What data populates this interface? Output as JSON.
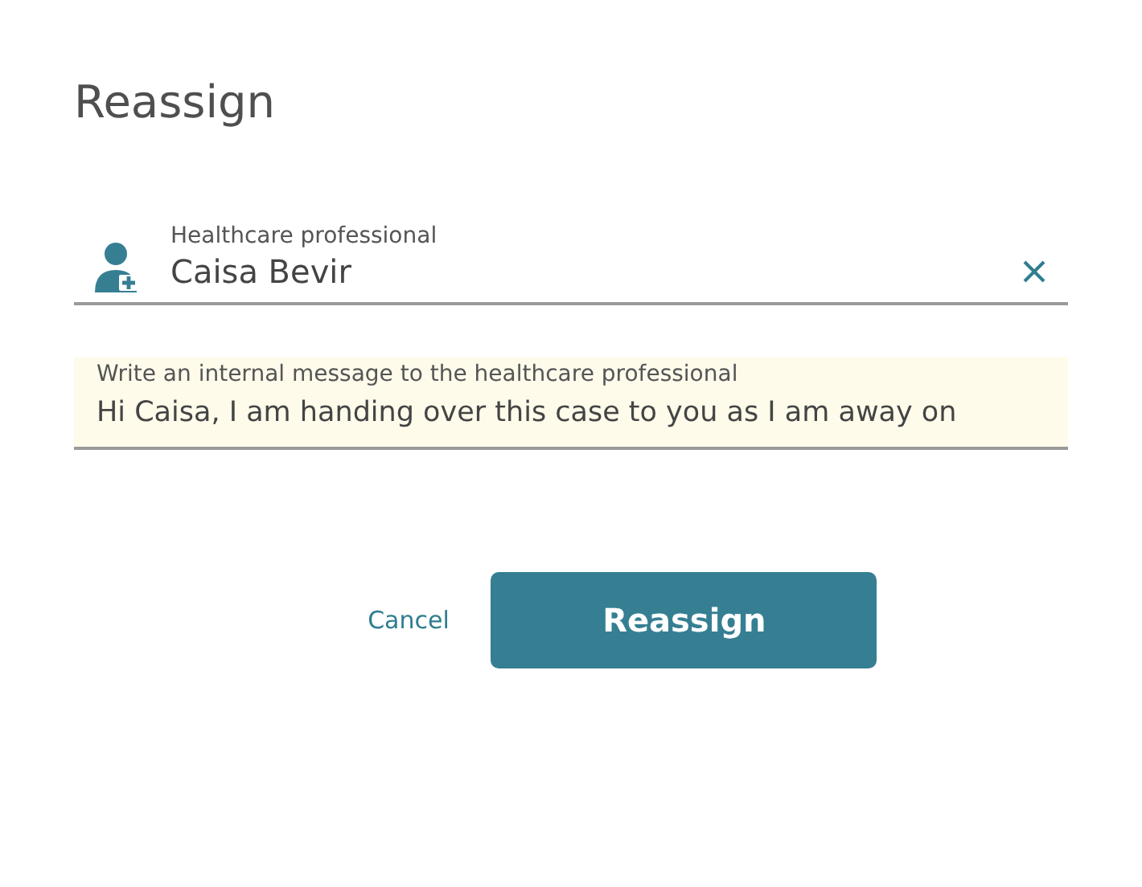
{
  "dialog": {
    "title": "Reassign"
  },
  "professional_field": {
    "label": "Healthcare professional",
    "value": "Caisa Bevir"
  },
  "message_field": {
    "label": "Write an internal message to the healthcare professional",
    "value": "Hi Caisa, I am handing over this case to you as I am away on"
  },
  "buttons": {
    "cancel": "Cancel",
    "confirm": "Reassign"
  }
}
